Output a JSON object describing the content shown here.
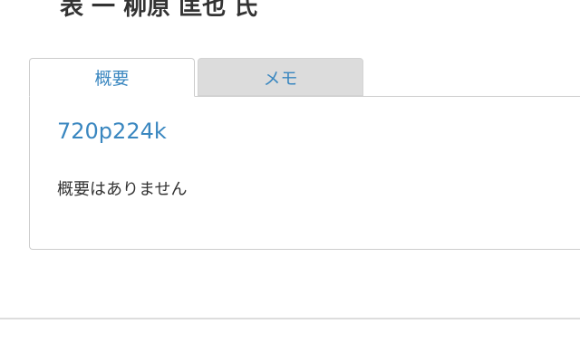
{
  "header": {
    "title": "表 一 柳原 匡也 氏"
  },
  "tabs": [
    {
      "label": "概要",
      "active": true
    },
    {
      "label": "メモ",
      "active": false
    }
  ],
  "panel": {
    "record_id": "720p224k",
    "summary": "概要はありません"
  },
  "colors": {
    "link": "#3a87c0",
    "text": "#333333",
    "tab_inactive_bg": "#dcdcdc",
    "border": "#cccccc"
  }
}
